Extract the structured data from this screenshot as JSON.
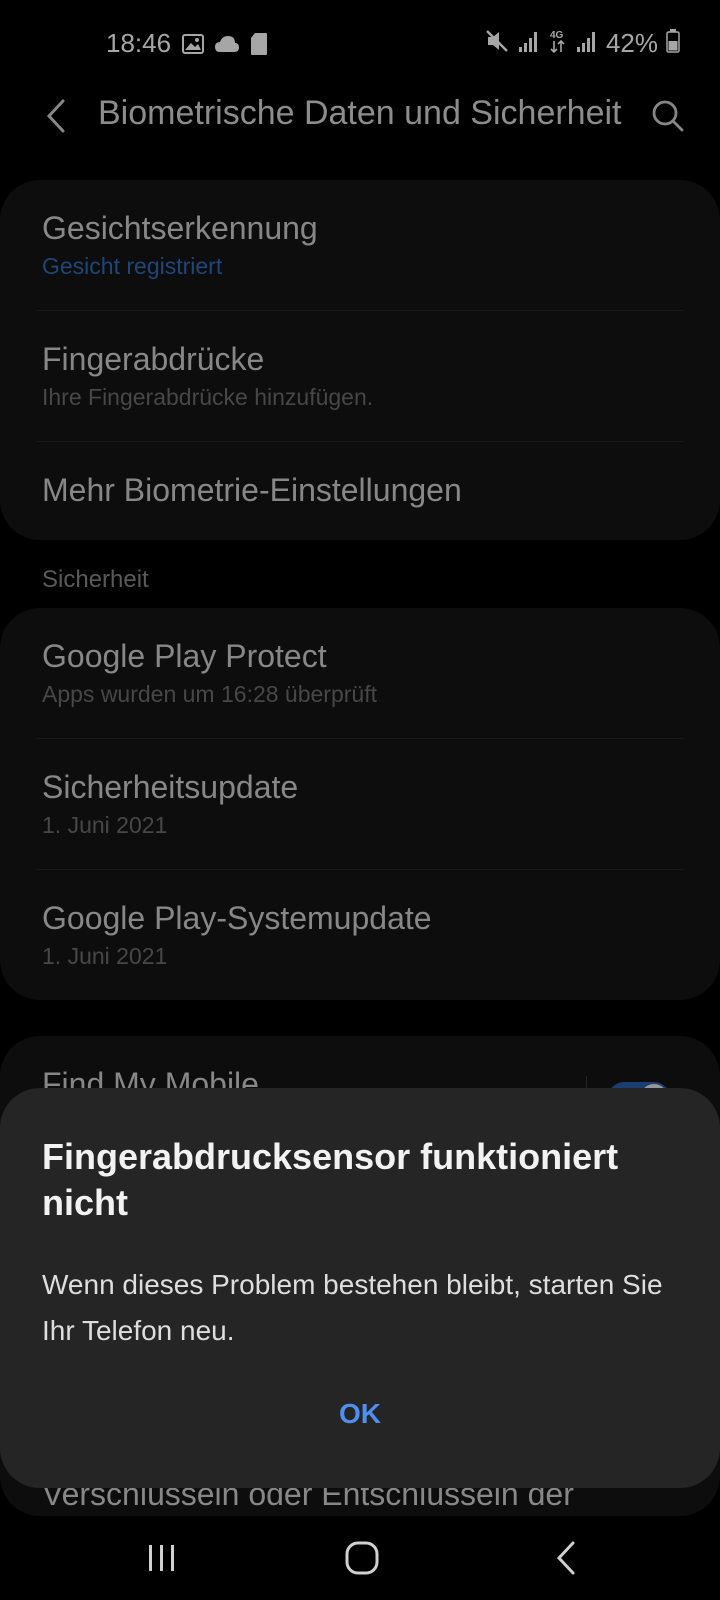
{
  "status_bar": {
    "time": "18:46",
    "battery_percent": "42%"
  },
  "app_bar": {
    "title": "Biometrische Daten und Sicherheit"
  },
  "biometrics": [
    {
      "title": "Gesichtserkennung",
      "subtitle": "Gesicht registriert"
    },
    {
      "title": "Fingerabdrücke",
      "subtitle": "Ihre Fingerabdrücke hinzufügen."
    },
    {
      "title": "Mehr Biometrie-Einstellungen",
      "subtitle": ""
    }
  ],
  "security_section": {
    "label": "Sicherheit",
    "items": [
      {
        "title": "Google Play Protect",
        "subtitle": "Apps wurden um 16:28 überprüft"
      },
      {
        "title": "Sicherheitsupdate",
        "subtitle": "1. Juni 2021"
      },
      {
        "title": "Google Play-Systemupdate",
        "subtitle": "1. Juni 2021"
      }
    ]
  },
  "find_my_mobile": {
    "title": "Find My Mobile",
    "enabled": true
  },
  "behind_dialog_text": "Verschlüsseln oder Entschlüsseln der",
  "dialog": {
    "title": "Fingerabdrucksensor funktioniert nicht",
    "body": "Wenn dieses Problem bestehen bleibt, starten Sie Ihr Telefon neu.",
    "ok_label": "OK"
  },
  "colors": {
    "accent_blue": "#4e8ff0",
    "subtitle_blue": "#2f6cb8",
    "card_bg": "#141414",
    "dialog_bg": "#252525"
  }
}
